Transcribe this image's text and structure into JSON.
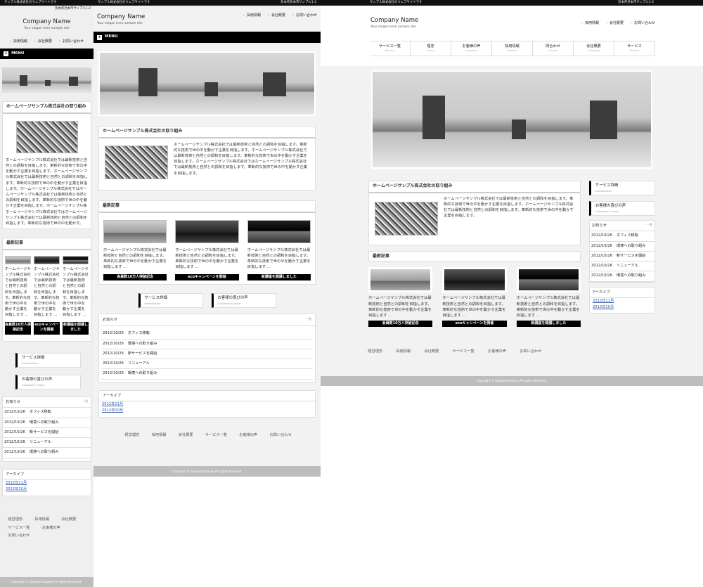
{
  "site": {
    "topbar_left": "サンプル株式会社のウェブサイトです",
    "topbar_right": "見本県見本市サンプル1-2",
    "company": "Company Name",
    "slogan": "Your slogan here sample site",
    "top_nav": [
      "採用情報",
      "会社概要",
      "お問い合わせ"
    ],
    "menu_label": "MENU",
    "menu_icon": "plus-icon"
  },
  "global_nav": [
    {
      "label": "サービス一覧",
      "sub": "Service"
    },
    {
      "label": "理念",
      "sub": "Vision"
    },
    {
      "label": "お客様の声",
      "sub": "Customer"
    },
    {
      "label": "採用情報",
      "sub": "Recruit"
    },
    {
      "label": "問合わせ",
      "sub": "Contact"
    },
    {
      "label": "会社概要",
      "sub": "Company"
    },
    {
      "label": "サービス",
      "sub": "Service"
    }
  ],
  "intro": {
    "heading": "ホームページサンプル株式会社の取り組み",
    "text_long": "ホームページサンプル株式会社では最新技術と自然との調和を目指します。革新的な技術で世の中を動かす企業を目指します。ホームページサンプル株式会社では最新技術と自然との調和を目指します。革新的な技術で世の中を動かす企業を目指します。ホームページサンプル株式会社ではホームページサンプル株式会社では最新技術と自然との調和を目指します。革新的な技術で世の中を動かす企業を目指します。ホームページサンプル株ホームページサンプル株式会社ではホームページサンプル株式会社では最新技術と自然との調和を目指します。革新的な技術で世の中を動かす。",
    "text_mid": "ホームページサンプル株式会社では最新技術と自然との調和を目指します。革新的な技術で世の中を動かす企業を目指します。ホームページサンプル株式会社では最新技術と自然との調和を目指します。革新的な技術で世の中を動かす企業を目指します。ホームページサンプル株式会社ではホームページサンプル株式会社では最新技術と自然との調和を目指します。革新的な技術で世の中を動かす企業を目指します。",
    "text_short": "ホームページサンプル株式会社では最新技術と自然との調和を目指します。革新的な技術で世の中を動かす企業を目指します。ホームページサンプル株式会社では最新技術と自然との調和を目指します。革新的な技術で世の中を動かす企業を目指します。"
  },
  "latest": {
    "heading": "最新記事",
    "item_text": "ホームページサンプル株式会社では最新技術と自然との調和を目指します。革新的な技術で世の中を動かす企業を目指します ...",
    "buttons": [
      "会員数10万人突破記念",
      "ecoキャンペーンを開催",
      "新講座を開講しました"
    ]
  },
  "banners": [
    {
      "label": "サービス詳細",
      "sub": "Introduction"
    },
    {
      "label": "お客様の喜びの声",
      "sub": "Customer's voice"
    }
  ],
  "news": {
    "heading": "お知らせ",
    "more": "一覧",
    "items": [
      {
        "date": "2012/10/26",
        "title": "オフィス移転"
      },
      {
        "date": "2012/10/26",
        "title": "環境への取り組み"
      },
      {
        "date": "2012/10/26",
        "title": "新サービスを開始"
      },
      {
        "date": "2012/10/26",
        "title": "リニューアル"
      },
      {
        "date": "2012/10/26",
        "title": "環境への取り組み"
      }
    ]
  },
  "archive": {
    "heading": "アーカイブ",
    "items": [
      "2012年11月",
      "2012年10月"
    ]
  },
  "footer": {
    "links": [
      "経営理念",
      "採用情報",
      "会社概要",
      "サービス一覧",
      "お客様の声",
      "お問い合わせ"
    ],
    "copyright": "Copyright © SampleCompany All rights Reserved."
  }
}
